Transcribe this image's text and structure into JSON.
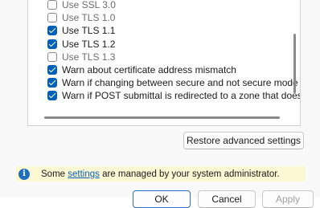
{
  "settings_list": {
    "items": [
      {
        "label": "Use SSL 3.0",
        "checked": false
      },
      {
        "label": "Use TLS 1.0",
        "checked": false
      },
      {
        "label": "Use TLS 1.1",
        "checked": true
      },
      {
        "label": "Use TLS 1.2",
        "checked": true
      },
      {
        "label": "Use TLS 1.3",
        "checked": false
      },
      {
        "label": "Warn about certificate address mismatch",
        "checked": true
      },
      {
        "label": "Warn if changing between secure and not secure mode",
        "checked": true
      },
      {
        "label": "Warn if POST submittal is redirected to a zone that does n",
        "checked": true
      }
    ]
  },
  "buttons": {
    "restore_label": "Restore advanced settings",
    "ok_label": "OK",
    "cancel_label": "Cancel",
    "apply_label": "Apply"
  },
  "info_bar": {
    "text_before": "Some ",
    "link_text": "settings",
    "text_after": " are managed by your system administrator.",
    "icon": "info-icon"
  },
  "colors": {
    "accent": "#005fb8",
    "info_bar_bg": "#fbf8d3",
    "link": "#0b5fb3"
  }
}
